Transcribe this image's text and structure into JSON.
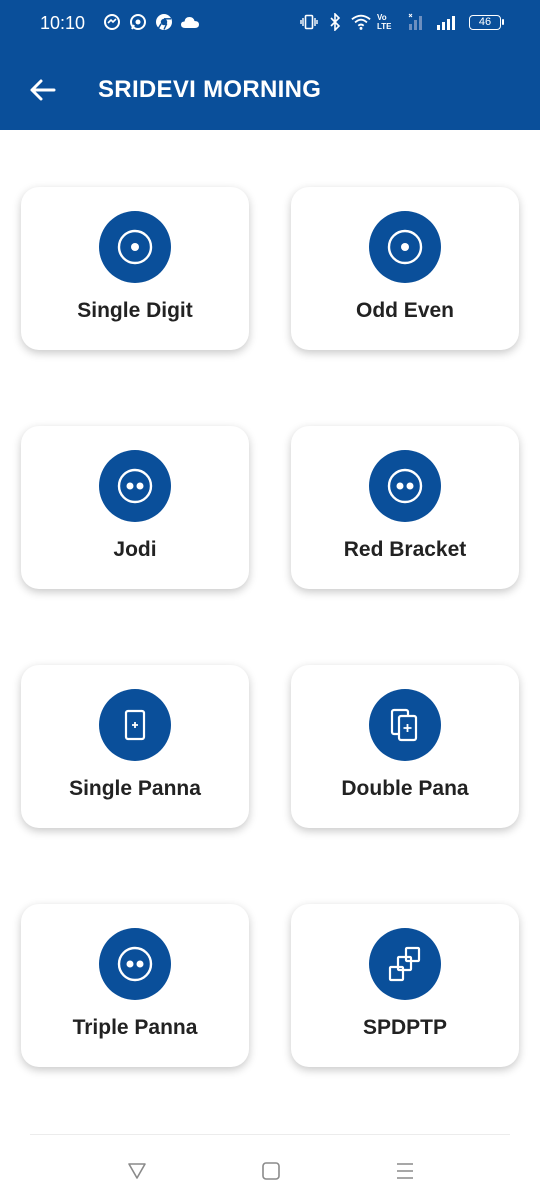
{
  "status_bar": {
    "time": "10:10",
    "left_icons": [
      "messenger-icon",
      "whatsapp-icon",
      "chrome-icon",
      "cloud-icon"
    ],
    "right_icons": [
      "vibrate-icon",
      "bluetooth-icon",
      "wifi-icon",
      "volte-icon",
      "signal-icon"
    ],
    "network_label": "Vo LTE",
    "battery_level": "46"
  },
  "app_bar": {
    "title": "SRIDEVI MORNING",
    "back_icon": "arrow-left-icon"
  },
  "games": [
    {
      "label": "Single Digit",
      "icon": "single-dot-icon"
    },
    {
      "label": "Odd Even",
      "icon": "single-dot-icon"
    },
    {
      "label": "Jodi",
      "icon": "double-dot-icon"
    },
    {
      "label": "Red Bracket",
      "icon": "double-dot-icon"
    },
    {
      "label": "Single Panna",
      "icon": "card-plus-icon"
    },
    {
      "label": "Double Pana",
      "icon": "double-card-plus-icon"
    },
    {
      "label": "Triple Panna",
      "icon": "double-dot-icon"
    },
    {
      "label": "SPDPTP",
      "icon": "linked-squares-icon"
    }
  ],
  "nav_bar": {
    "buttons": [
      "back-triangle-icon",
      "home-square-icon",
      "menu-lines-icon"
    ]
  },
  "colors": {
    "primary": "#0a4f9a",
    "card_bg": "#ffffff",
    "label_text": "#222222"
  }
}
